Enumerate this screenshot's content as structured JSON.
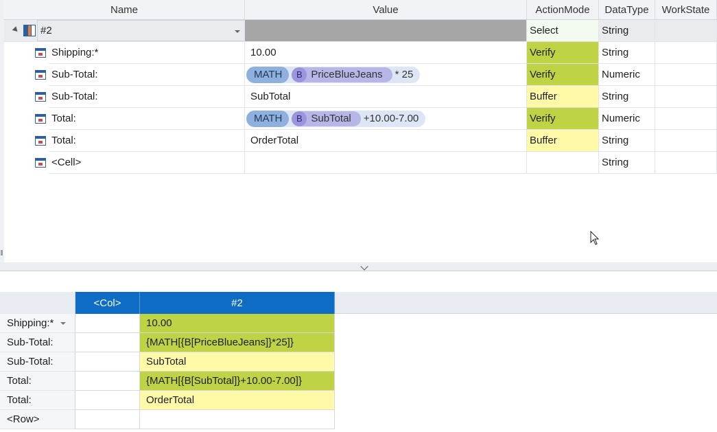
{
  "top_grid": {
    "columns": [
      "Name",
      "Value",
      "ActionMode",
      "DataType",
      "WorkState"
    ],
    "group_row": {
      "name": "#2",
      "value": "",
      "action_mode": "Select",
      "data_type": "String",
      "work_state": ""
    },
    "rows": [
      {
        "name": "Shipping:*",
        "value": "10.00",
        "action_mode": "Verify",
        "data_type": "String",
        "work_state": ""
      },
      {
        "name": "Sub-Total:",
        "value_math": "MATH",
        "value_b": "B",
        "value_b_text": "PriceBlueJeans",
        "value_after": "* 25",
        "action_mode": "Verify",
        "data_type": "Numeric",
        "work_state": ""
      },
      {
        "name": "Sub-Total:",
        "value": "SubTotal",
        "action_mode": "Buffer",
        "data_type": "String",
        "work_state": ""
      },
      {
        "name": "Total:",
        "value_math": "MATH",
        "value_b": "B",
        "value_b_text": "SubTotal",
        "value_after": "+10.00-7.00",
        "action_mode": "Verify",
        "data_type": "Numeric",
        "work_state": ""
      },
      {
        "name": "Total:",
        "value": "OrderTotal",
        "action_mode": "Buffer",
        "data_type": "String",
        "work_state": ""
      },
      {
        "name": "<Cell>",
        "value": "",
        "action_mode": "",
        "data_type": "String",
        "work_state": ""
      }
    ]
  },
  "bottom_grid": {
    "col_headers": [
      "<Col>",
      "#2"
    ],
    "rows": [
      {
        "header": "Shipping:*",
        "col": "",
        "value": "10.00",
        "state": "verify"
      },
      {
        "header": "Sub-Total:",
        "col": "",
        "value": "{MATH[{B[PriceBlueJeans]}*25]}",
        "state": "verify"
      },
      {
        "header": "Sub-Total:",
        "col": "",
        "value": "SubTotal",
        "state": "buffer"
      },
      {
        "header": "Total:",
        "col": "",
        "value": "{MATH[{B[SubTotal]}+10.00-7.00]}",
        "state": "verify"
      },
      {
        "header": "Total:",
        "col": "",
        "value": "OrderTotal",
        "state": "buffer"
      },
      {
        "header": "<Row>",
        "col": "",
        "value": "",
        "state": "none"
      }
    ]
  },
  "colors": {
    "verify": "#bfd345",
    "buffer": "#fff9a8",
    "select": "#f3fbf1",
    "header_accent": "#0f6cc4"
  },
  "icons": [
    "table-icon",
    "row-item-icon",
    "expand-arrow-icon",
    "dropdown-arrow-icon",
    "splitter-chevron-icon",
    "mouse-cursor-icon"
  ]
}
